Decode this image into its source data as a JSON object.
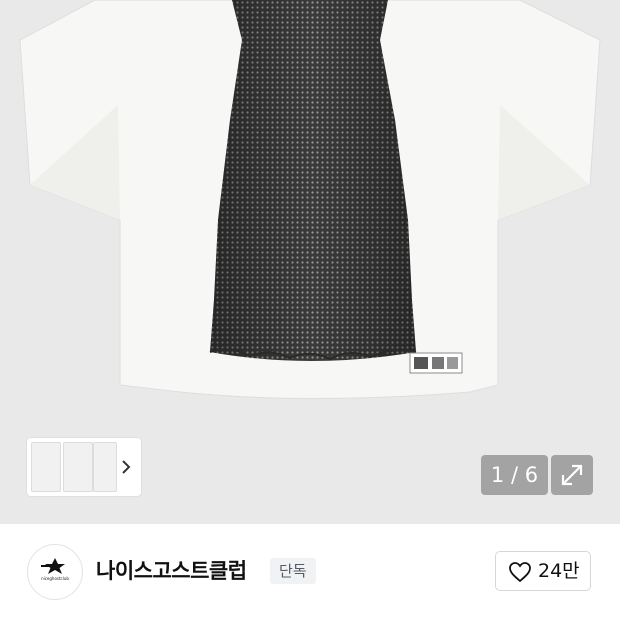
{
  "gallery": {
    "current_page": 1,
    "total_pages": 6,
    "page_counter_text": "1 / 6",
    "expand_icon": "expand-arrows-icon",
    "next_thumb_icon": "chevron-right-icon"
  },
  "brand": {
    "name": "나이스고스트클럽",
    "badge": "단독",
    "logo_text": "niceghostclub",
    "like_count": "24만",
    "like_icon": "heart-outline-icon"
  },
  "colors": {
    "image_background": "#e9e9e9",
    "badge_background": "#f1f2f4",
    "counter_background": "#969696"
  }
}
